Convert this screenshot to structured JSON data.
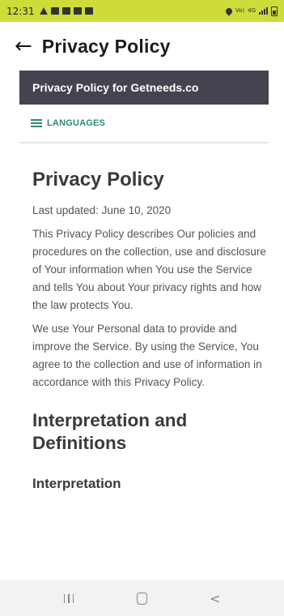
{
  "status_bar": {
    "time": "12:31",
    "network_label": "Vo) 4G\nLTE1",
    "network_type": "4G"
  },
  "app_bar": {
    "back_icon": "arrow-left-icon",
    "title": "Privacy Policy"
  },
  "site_header": {
    "title": "Privacy Policy for Getneeds.co"
  },
  "languages": {
    "icon": "hamburger-menu-icon",
    "label": "LANGUAGES"
  },
  "document": {
    "heading": "Privacy Policy",
    "last_updated": "Last updated: June 10, 2020",
    "paragraphs": [
      "This Privacy Policy describes Our policies and procedures on the collection, use and disclosure of Your information when You use the Service and tells You about Your privacy rights and how the law protects You.",
      "We use Your Personal data to provide and improve the Service. By using the Service, You agree to the collection and use of information in accordance with this Privacy Policy."
    ],
    "section_heading": "Interpretation and Definitions",
    "subsection_heading": "Interpretation"
  },
  "nav_bar": {
    "recents_icon": "recents-icon",
    "home_icon": "home-icon",
    "back_icon": "back-chevron-icon"
  },
  "colors": {
    "status_bar_bg": "#cddc39",
    "header_bg": "#444450",
    "accent": "#2b8a73",
    "nav_bar_bg": "#f2f2f2"
  }
}
